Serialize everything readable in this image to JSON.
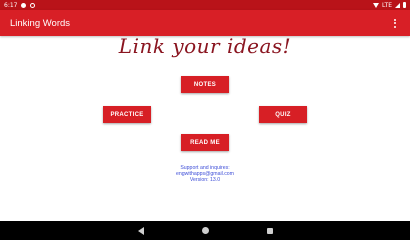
{
  "status_bar": {
    "time": "6:17",
    "network": "LTE",
    "icons": [
      "notification-icon",
      "sync-icon",
      "wifi-icon",
      "signal-icon",
      "battery-icon"
    ]
  },
  "app_bar": {
    "title": "Linking Words",
    "menu_icon": "overflow-menu-icon"
  },
  "main": {
    "headline": "Link your ideas!",
    "buttons": {
      "notes": "NOTES",
      "practice": "PRACTICE",
      "quiz": "QUIZ",
      "read_me": "READ ME"
    },
    "support": {
      "line1": "Support and inquires:",
      "line2": "engwithapps@gmail.com",
      "line3": "Version: 13.0"
    }
  },
  "nav_bar": {
    "icons": [
      "back-icon",
      "home-icon",
      "recents-icon"
    ]
  },
  "colors": {
    "status_bar": "#b91319",
    "app_bar": "#d81f26",
    "button": "#d71f25",
    "headline": "#8a1520",
    "support_text": "#3f4fd8"
  }
}
